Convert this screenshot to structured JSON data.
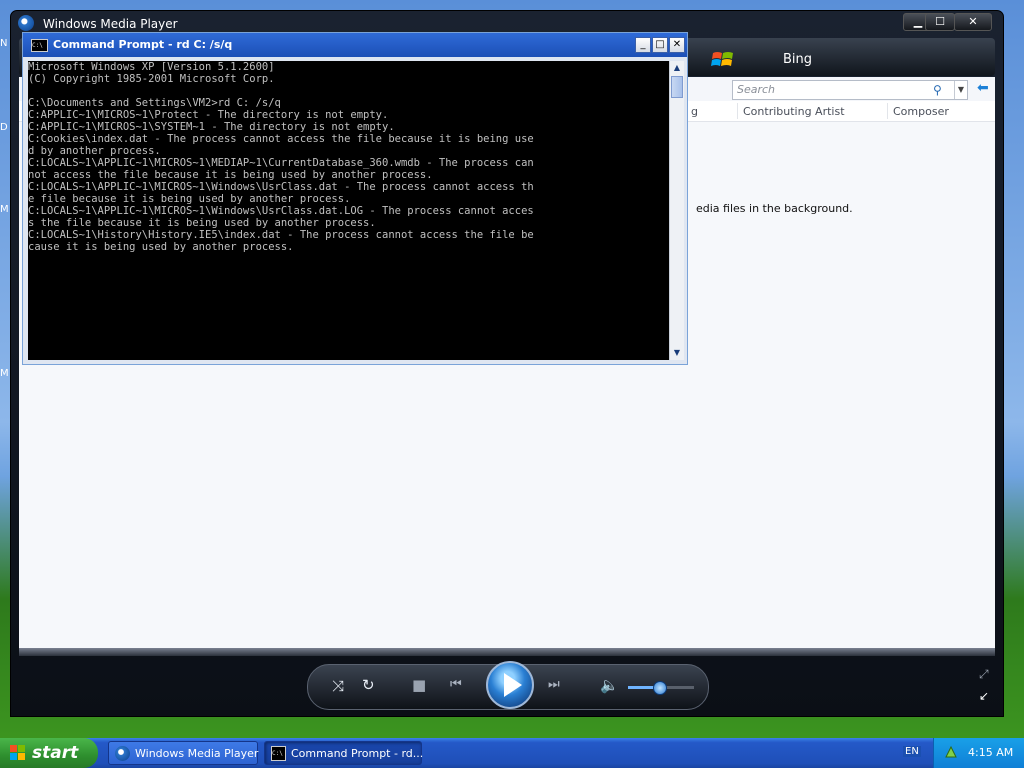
{
  "desktop": {
    "left_edge_letters": [
      "N",
      "D",
      "M",
      "M"
    ]
  },
  "wmp": {
    "title": "Windows Media Player",
    "buttons": {
      "minimize": "▁",
      "maximize": "☐",
      "close": "✕"
    },
    "nav": {
      "bing_label": "Bing"
    },
    "search": {
      "placeholder": "Search"
    },
    "columns": {
      "partial": "g",
      "contributing_artist": "Contributing Artist",
      "composer": "Composer"
    },
    "content": {
      "message": "edia files in the background."
    }
  },
  "cmd": {
    "title": "Command Prompt - rd C: /s/q",
    "output": "Microsoft Windows XP [Version 5.1.2600]\n(C) Copyright 1985-2001 Microsoft Corp.\n\nC:\\Documents and Settings\\VM2>rd C: /s/q\nC:APPLIC~1\\MICROS~1\\Protect - The directory is not empty.\nC:APPLIC~1\\MICROS~1\\SYSTEM~1 - The directory is not empty.\nC:Cookies\\index.dat - The process cannot access the file because it is being use\nd by another process.\nC:LOCALS~1\\APPLIC~1\\MICROS~1\\MEDIAP~1\\CurrentDatabase_360.wmdb - The process can\nnot access the file because it is being used by another process.\nC:LOCALS~1\\APPLIC~1\\MICROS~1\\Windows\\UsrClass.dat - The process cannot access th\ne file because it is being used by another process.\nC:LOCALS~1\\APPLIC~1\\MICROS~1\\Windows\\UsrClass.dat.LOG - The process cannot acces\ns the file because it is being used by another process.\nC:LOCALS~1\\History\\History.IE5\\index.dat - The process cannot access the file be\ncause it is being used by another process."
  },
  "taskbar": {
    "start_label": "start",
    "tasks": [
      {
        "label": "Windows Media Player",
        "active": false
      },
      {
        "label": "Command Prompt - rd...",
        "active": true
      }
    ],
    "language": "EN",
    "clock": "4:15 AM"
  },
  "colors": {
    "cmd_background": "#000000",
    "cmd_text": "#c0c0c0",
    "xp_title_blue": "#2f6bd8"
  }
}
